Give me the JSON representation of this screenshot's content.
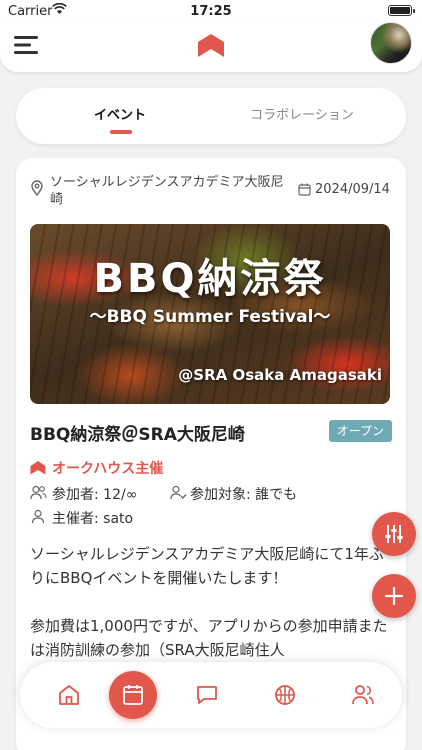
{
  "status_bar": {
    "carrier": "Carrier",
    "time": "17:25"
  },
  "tabs": [
    {
      "label": "イベント",
      "active": true
    },
    {
      "label": "コラボレーション",
      "active": false
    }
  ],
  "event": {
    "location": "ソーシャルレジデンスアカデミア大阪尼崎",
    "date": "2024/09/14",
    "banner": {
      "title": "BBQ納涼祭",
      "subtitle": "〜BBQ Summer Festival〜",
      "footer": "@SRA Osaka Amagasaki"
    },
    "title": "BBQ納涼祭＠SRA大阪尼崎",
    "status": "オープン",
    "organizer_house": "オークハウス主催",
    "participants": "参加者: 12/∞",
    "target": "参加対象: 誰でも",
    "host": "主催者: sato",
    "description": [
      "ソーシャルレジデンスアカデミア大阪尼崎にて1年ぶりにBBQイベントを開催いたします！",
      "参加費は1,000円ですが、アプリからの参加申請または消防訓練の参加（SRA大阪尼崎住人"
    ]
  },
  "bottom_nav": [
    "home-icon",
    "calendar-icon",
    "chat-icon",
    "sports-icon",
    "users-icon"
  ],
  "colors": {
    "accent": "#e2574c",
    "badge": "#6fa9b4",
    "background": "#f2f2f2"
  }
}
